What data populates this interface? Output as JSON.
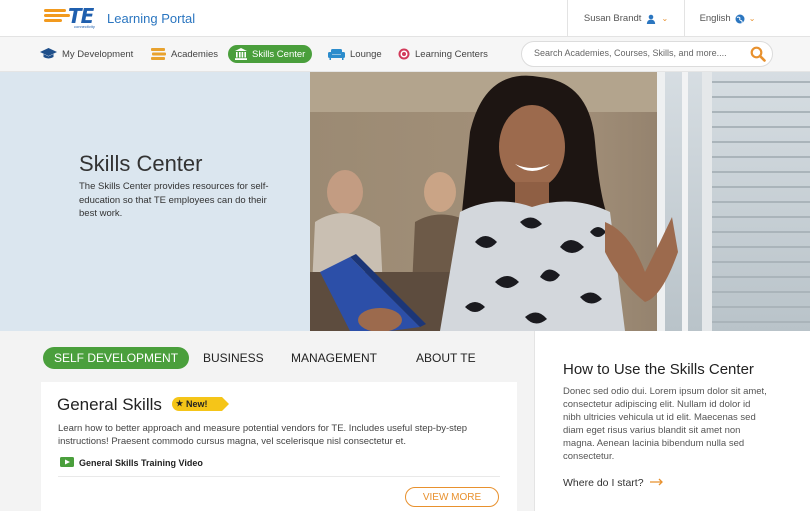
{
  "header": {
    "logo_text": "TE",
    "logo_subtext": "connectivity",
    "portal_title": "Learning Portal",
    "user_name": "Susan Brandt",
    "language": "English",
    "brand_colors": {
      "blue": "#1f5fae",
      "orange": "#e8912e",
      "green": "#4a9f3c"
    }
  },
  "nav": {
    "items": [
      {
        "label": "My Development",
        "icon": "graduation-cap-icon"
      },
      {
        "label": "Academies",
        "icon": "book-stack-icon"
      },
      {
        "label": "Skills Center",
        "icon": "institution-icon",
        "active": true
      },
      {
        "label": "Lounge",
        "icon": "sofa-icon"
      },
      {
        "label": "Learning Centers",
        "icon": "target-icon"
      }
    ],
    "search_placeholder": "Search Academies, Courses, Skills, and more...."
  },
  "hero": {
    "title": "Skills Center",
    "description": "The Skills Center provides resources for self-education so that TE employees can do their best work."
  },
  "tabs": [
    {
      "label": "SELF DEVELOPMENT",
      "active": true
    },
    {
      "label": "BUSINESS"
    },
    {
      "label": "MANAGEMENT"
    },
    {
      "label": "ABOUT TE"
    }
  ],
  "card": {
    "title": "General Skills",
    "badge": "New!",
    "description": "Learn how to better approach and measure potential vendors for TE. Includes useful step-by-step instructions! Praesent commodo cursus magna, vel scelerisque nisl consectetur et.",
    "video_label": "General Skills Training Video",
    "button_label": "VIEW MORE"
  },
  "side": {
    "title": "How to Use the Skills Center",
    "text": "Donec sed odio dui. Lorem ipsum dolor sit amet, consectetur adipiscing elit. Nullam id dolor id nibh ultricies vehicula ut id elit. Maecenas sed diam eget risus varius blandit sit amet non magna. Aenean lacinia bibendum nulla sed consectetur.",
    "link_label": "Where do I start?"
  }
}
